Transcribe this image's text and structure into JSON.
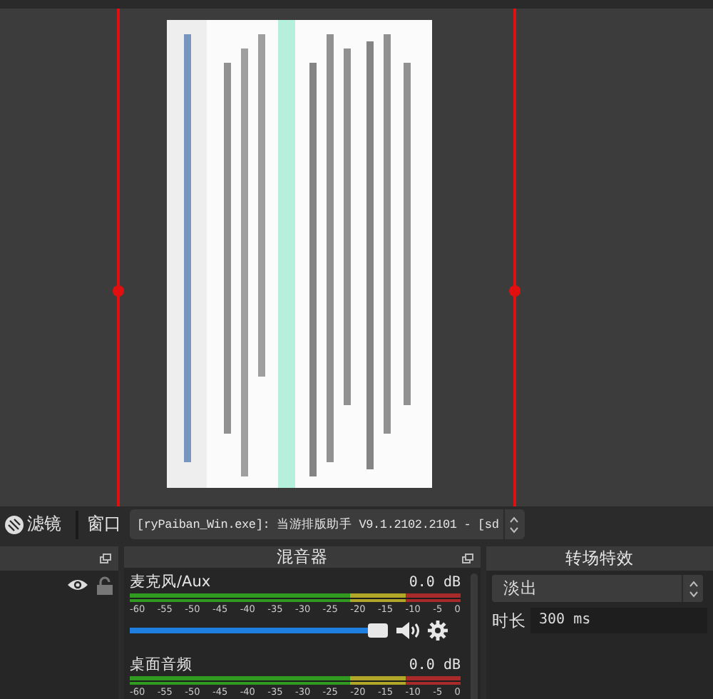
{
  "toolbar": {
    "filters_button": "滤镜",
    "window_label": "窗口",
    "window_select": "[ryPaiban_Win.exe]: 当游排版助手 V9.1.2102.2101 - [sd"
  },
  "sources_dock": {
    "visible": true,
    "locked": false
  },
  "mixer": {
    "title": "混音器",
    "channels": [
      {
        "name": "麦克风/Aux",
        "reading": "0.0 dB",
        "ticks": [
          "-60",
          "-55",
          "-50",
          "-45",
          "-40",
          "-35",
          "-30",
          "-25",
          "-20",
          "-15",
          "-10",
          "-5",
          "0"
        ],
        "level": 1,
        "muted": false
      },
      {
        "name": "桌面音频",
        "reading": "0.0 dB",
        "ticks": [
          "-60",
          "-55",
          "-50",
          "-45",
          "-40",
          "-35",
          "-30",
          "-25",
          "-20",
          "-15",
          "-10",
          "-5",
          "0"
        ]
      }
    ]
  },
  "transitions": {
    "title": "转场特效",
    "transition": "淡出",
    "duration_label": "时长",
    "duration": "300 ms"
  }
}
